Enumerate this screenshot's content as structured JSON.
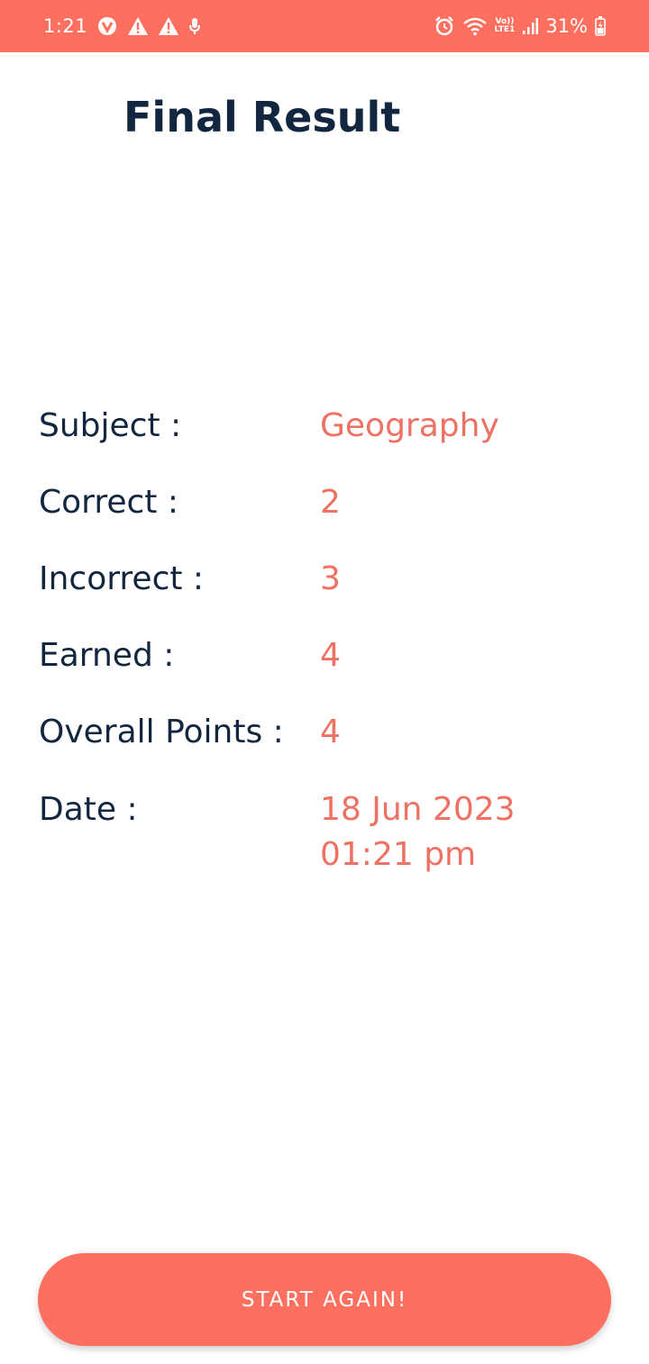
{
  "status_bar": {
    "time": "1:21",
    "battery": "31%",
    "network_label_top": "Vo))",
    "network_label_bottom": "LTE1",
    "icons_left": [
      "vpn-icon",
      "warning-icon",
      "warning-icon",
      "microphone-icon"
    ],
    "icons_right": [
      "alarm-icon",
      "wifi-icon",
      "volte-icon",
      "signal-icon",
      "battery-icon"
    ]
  },
  "page": {
    "title": "Final Result"
  },
  "results": [
    {
      "label": "Subject :",
      "value": "Geography"
    },
    {
      "label": "Correct :",
      "value": "2"
    },
    {
      "label": "Incorrect :",
      "value": "3"
    },
    {
      "label": "Earned :",
      "value": "4"
    },
    {
      "label": "Overall Points :",
      "value": "4"
    },
    {
      "label": "Date :",
      "value_line1": "18 Jun 2023",
      "value_line2": "01:21 pm"
    }
  ],
  "actions": {
    "start_again_label": "START AGAIN!"
  },
  "colors": {
    "accent": "#fd6f5e",
    "heading": "#13263f",
    "value": "#ee7163"
  }
}
